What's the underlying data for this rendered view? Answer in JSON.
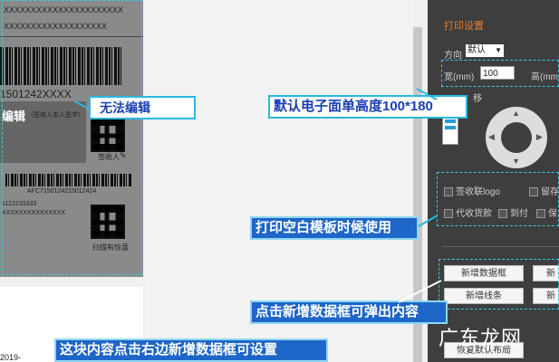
{
  "label": {
    "masked_line_1": "XXXXXXXXXXXXXXXXXXXXXX",
    "masked_line_2": "XXXXXXXXXXXXXXXXXXX",
    "tracking_number": "1501242XXXX",
    "edit_fragment": "编辑",
    "signer_label": "签收人",
    "signer_note": "（签收人本人签字）",
    "small_barcode_text": "AFC7150124215012424",
    "sender_number": "1122233333",
    "sender_masked": "XXXXXXXXXXXXXXX",
    "scan_caption": "扫描有惊喜"
  },
  "canvas": {
    "date_stub": "2019-"
  },
  "right_panel": {
    "section_title": "打印设置",
    "direction_label": "方向",
    "direction_value": "默认",
    "width_label": "宽(mm)",
    "width_value": "100",
    "height_label": "高(mm",
    "move_label": "移",
    "checkbox_sign_logo": "签收联logo",
    "checkbox_keep": "留存",
    "checkbox_cod": "代收货款",
    "checkbox_arrive_pay": "到付",
    "checkbox_insure": "保",
    "btn_add_data_box": "新增数据框",
    "btn_add_data_box_2": "新",
    "btn_add_line": "新增线条",
    "btn_add_2": "新",
    "btn_restore_layout": "恢复默认布局"
  },
  "annotations": {
    "not_editable": "无法编辑",
    "default_height": "默认电子面单高度100*180",
    "blank_template": "打印空白模板时候使用",
    "click_add_box": "点击新增数据框可弹出内容",
    "content_settable": "这块内容点击右边新增数据框可设置"
  },
  "watermark": "广东龙网",
  "colors": {
    "annotation_border": "#29b8e0",
    "annotation_text": "#1a3fb3",
    "dark_callout_bg": "#1e66c8",
    "panel_bg": "#3e3e3e",
    "selection_dash": "#39c8e8"
  }
}
